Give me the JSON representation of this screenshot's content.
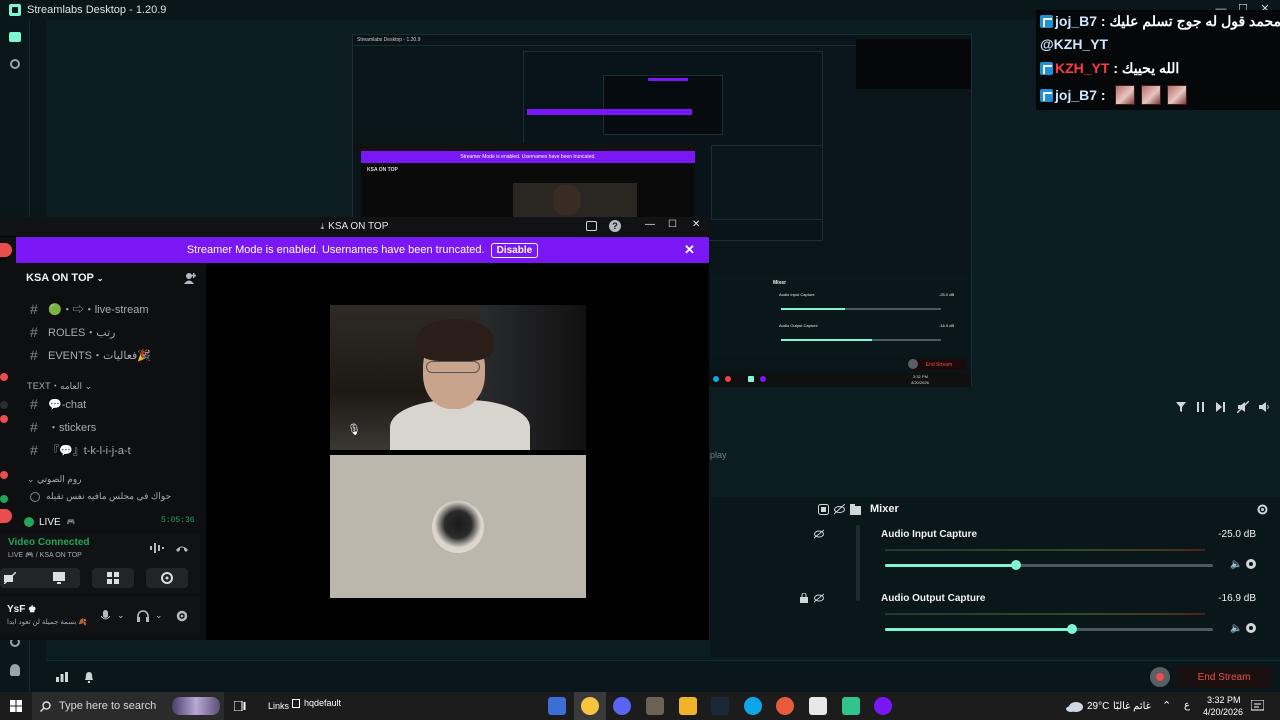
{
  "streamlabs": {
    "window_title": "Streamlabs Desktop - 1.20.9",
    "end_stream_label": "End Stream",
    "colors": {
      "accent": "#80f5d2",
      "end_stream": "#e84e4e",
      "bg": "#09161a"
    }
  },
  "chat": {
    "lines": [
      {
        "user": "joj_B7",
        "sep": " : ",
        "message": "محمد قول له جوج تسلم عليك",
        "emotes": 0
      },
      {
        "user": "",
        "sep": "",
        "message": "@KZH_YT",
        "emotes": 0
      },
      {
        "user": "KZH_YT",
        "sep": " : ",
        "message": "الله يحييك",
        "emotes": 0
      },
      {
        "user": "joj_B7",
        "sep": " : ",
        "message": "",
        "emotes": 3
      }
    ]
  },
  "mixer": {
    "title": "Mixer",
    "sources": [
      {
        "name": "Audio Input Capture",
        "db": "-25.0 dB",
        "level": 0.4
      },
      {
        "name": "Audio Output Capture",
        "db": "-16.9 dB",
        "level": 0.57
      }
    ],
    "stray_text": "play"
  },
  "discord": {
    "window_title": "KSA ON TOP",
    "banner_text": "Streamer Mode is enabled. Usernames have been truncated.",
    "banner_button": "Disable",
    "server_name": "KSA ON TOP",
    "channels": [
      {
        "icon": "#",
        "name": "🟢・⇨・live-stream"
      },
      {
        "icon": "#",
        "name": "ROLES・رتب"
      },
      {
        "icon": "#",
        "name": "EVENTS・فعاليات🎉"
      }
    ],
    "category_text": "TEXT・العامه",
    "text_channels": [
      {
        "icon": "#",
        "name": "💬-chat"
      },
      {
        "icon": "#",
        "name": "・stickers"
      },
      {
        "icon": "#",
        "name": "『💬』t-k-l-i-j-a-t"
      }
    ],
    "category_voice": "روم الصوتي",
    "voice_channel": "حواك في مجلس مافيه نفس تقيله",
    "live_label": "LIVE",
    "live_timer": "5:05:36",
    "video_connected": "Video Connected",
    "voice_location": "LIVE 🎮 / KSA ON TOP",
    "user_name": "YsF",
    "user_status": "بسمة جميلة لن تعود ابدا 🍂",
    "colors": {
      "banner": "#7a17f5",
      "connected": "#23a55a"
    }
  },
  "taskbar": {
    "search_placeholder": "Type here to search",
    "links_label": "Links",
    "window_label": "hqdefault",
    "weather_temp": "29°C",
    "weather_text": "غائم غالبًا",
    "lang": "ع",
    "time": "3:32 PM",
    "date": "4/20/2026"
  },
  "nested": {
    "mini_title": "Streamlabs Desktop - 1.20.9",
    "mini_banner": "Streamer Mode is enabled. Usernames have been truncated.",
    "mini_server": "KSA ON TOP",
    "mini_time": "3:32 PM",
    "mini_date": "4/20/2026",
    "mini_mixer": "Mixer",
    "mini_input": "Audio Input Capture",
    "mini_output": "Audio Output Capture",
    "mini_input_db": "-25.0 dB",
    "mini_output_db": "-16.9 dB",
    "mini_end": "End Stream"
  }
}
